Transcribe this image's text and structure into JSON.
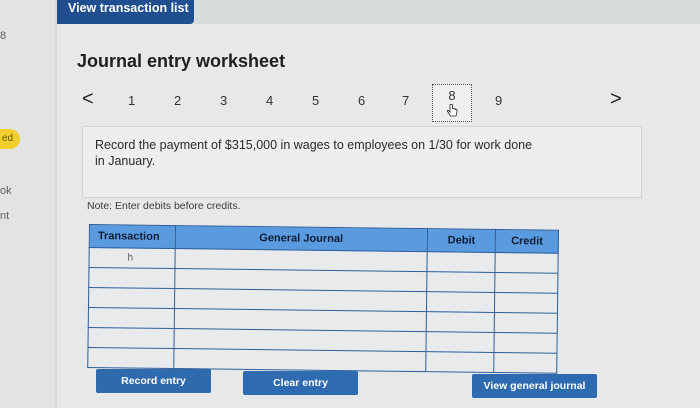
{
  "top_tab": {
    "label": "View transaction list"
  },
  "left_strip": {
    "items": [
      "8",
      "ed",
      "ok",
      "nt"
    ]
  },
  "worksheet": {
    "title": "Journal entry worksheet",
    "pager": {
      "prev": "<",
      "next": ">",
      "pages": [
        "1",
        "2",
        "3",
        "4",
        "5",
        "6",
        "7",
        "8",
        "9"
      ],
      "active": "8"
    },
    "instruction": "Record the payment of $315,000 in wages to employees on 1/30 for work done in January.",
    "note": "Note: Enter debits before credits."
  },
  "table": {
    "headers": {
      "transaction": "Transaction",
      "journal": "General Journal",
      "debit": "Debit",
      "credit": "Credit"
    },
    "rows": [
      {
        "transaction": "h",
        "journal": "",
        "debit": "",
        "credit": ""
      },
      {
        "transaction": "",
        "journal": "",
        "debit": "",
        "credit": ""
      },
      {
        "transaction": "",
        "journal": "",
        "debit": "",
        "credit": ""
      },
      {
        "transaction": "",
        "journal": "",
        "debit": "",
        "credit": ""
      },
      {
        "transaction": "",
        "journal": "",
        "debit": "",
        "credit": ""
      },
      {
        "transaction": "",
        "journal": "",
        "debit": "",
        "credit": ""
      }
    ]
  },
  "buttons": {
    "record": "Record entry",
    "clear": "Clear entry",
    "view": "View general journal"
  },
  "colors": {
    "tab": "#1f4f8e",
    "header": "#5a9be0",
    "button": "#2f6aad",
    "badge": "#f2cf2f"
  }
}
